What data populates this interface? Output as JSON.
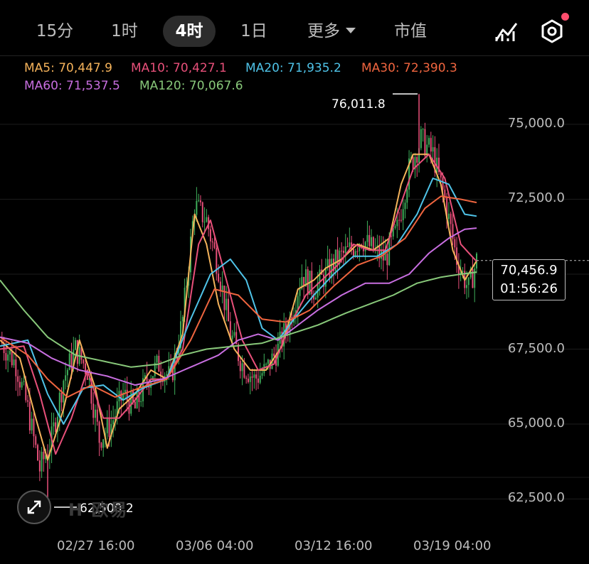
{
  "tabs": [
    {
      "label": "15分",
      "active": false
    },
    {
      "label": "1时",
      "active": false
    },
    {
      "label": "4时",
      "active": true
    },
    {
      "label": "1日",
      "active": false
    },
    {
      "label": "更多",
      "active": false
    },
    {
      "label": "市值",
      "active": false
    }
  ],
  "tools": {
    "indicator_icon": "chart-indicator-icon",
    "settings_icon": "hex-settings-icon",
    "notification_dot_color": "#ff4d6d"
  },
  "ma_legend": [
    {
      "text": "MA5: 70,447.9",
      "color": "#f5b35b"
    },
    {
      "text": "MA10: 70,427.1",
      "color": "#e8507a"
    },
    {
      "text": "MA20: 71,935.2",
      "color": "#4fc3e8"
    },
    {
      "text": "MA30: 72,390.3",
      "color": "#f0653f"
    },
    {
      "text": "MA60: 71,537.5",
      "color": "#c86ee0"
    },
    {
      "text": "MA120: 70,067.6",
      "color": "#88c87a"
    }
  ],
  "watermark": "欧易",
  "current": {
    "price": "70,456.9",
    "countdown": "01:56:26"
  },
  "annotations": {
    "high": "76,011.8",
    "low": "62,500.2"
  },
  "chart_data": {
    "type": "line",
    "title": "",
    "x_tick_labels": [
      "02/27 16:00",
      "03/06 04:00",
      "03/12 16:00",
      "03/19 04:00"
    ],
    "y_tick_labels": [
      "75,000.0",
      "72,500.0",
      "67,500.0",
      "65,000.0",
      "62,500.0"
    ],
    "ylim": [
      62000,
      77000
    ],
    "grid": true,
    "up_color": "#3fb05b",
    "down_color": "#e8507a",
    "candles_summary": {
      "high": 76011.8,
      "low": 62500.2,
      "last": 70456.9
    },
    "close_path": [
      [
        0,
        67800
      ],
      [
        8,
        67000
      ],
      [
        14,
        65500
      ],
      [
        20,
        63500
      ],
      [
        26,
        64500
      ],
      [
        32,
        66500
      ],
      [
        38,
        67500
      ],
      [
        44,
        66800
      ],
      [
        50,
        64500
      ],
      [
        56,
        65000
      ],
      [
        62,
        66000
      ],
      [
        68,
        65500
      ],
      [
        74,
        66500
      ],
      [
        80,
        67000
      ],
      [
        86,
        66500
      ],
      [
        92,
        68500
      ],
      [
        98,
        72300
      ],
      [
        104,
        71800
      ],
      [
        110,
        70200
      ],
      [
        116,
        68000
      ],
      [
        122,
        67000
      ],
      [
        128,
        66500
      ],
      [
        134,
        66800
      ],
      [
        140,
        67500
      ],
      [
        146,
        68500
      ],
      [
        152,
        70000
      ],
      [
        158,
        69500
      ],
      [
        164,
        70000
      ],
      [
        170,
        70500
      ],
      [
        176,
        70800
      ],
      [
        182,
        71200
      ],
      [
        188,
        70800
      ],
      [
        194,
        70500
      ],
      [
        200,
        71500
      ],
      [
        206,
        73500
      ],
      [
        212,
        74500
      ],
      [
        218,
        74000
      ],
      [
        224,
        72500
      ],
      [
        230,
        70500
      ],
      [
        236,
        69500
      ],
      [
        240,
        70456.9
      ]
    ],
    "series": [
      {
        "name": "MA5",
        "color": "#f5b35b",
        "values": [
          [
            0,
            67800
          ],
          [
            10,
            67200
          ],
          [
            18,
            65200
          ],
          [
            24,
            63800
          ],
          [
            32,
            65500
          ],
          [
            40,
            67800
          ],
          [
            48,
            66200
          ],
          [
            54,
            64200
          ],
          [
            60,
            65500
          ],
          [
            68,
            66000
          ],
          [
            76,
            66800
          ],
          [
            84,
            66500
          ],
          [
            92,
            68000
          ],
          [
            98,
            72000
          ],
          [
            104,
            71000
          ],
          [
            110,
            69000
          ],
          [
            118,
            67500
          ],
          [
            126,
            66800
          ],
          [
            134,
            66800
          ],
          [
            142,
            67600
          ],
          [
            150,
            69500
          ],
          [
            158,
            69800
          ],
          [
            164,
            70200
          ],
          [
            172,
            70500
          ],
          [
            180,
            71000
          ],
          [
            188,
            70800
          ],
          [
            196,
            71200
          ],
          [
            202,
            73000
          ],
          [
            208,
            74000
          ],
          [
            216,
            74000
          ],
          [
            222,
            73000
          ],
          [
            228,
            70800
          ],
          [
            234,
            69800
          ],
          [
            240,
            70447.9
          ]
        ]
      },
      {
        "name": "MA10",
        "color": "#e8507a",
        "values": [
          [
            0,
            67500
          ],
          [
            12,
            67600
          ],
          [
            20,
            66000
          ],
          [
            28,
            64000
          ],
          [
            36,
            65200
          ],
          [
            44,
            66800
          ],
          [
            52,
            65200
          ],
          [
            60,
            65200
          ],
          [
            68,
            65800
          ],
          [
            76,
            66500
          ],
          [
            84,
            66500
          ],
          [
            92,
            67500
          ],
          [
            100,
            71000
          ],
          [
            106,
            71800
          ],
          [
            114,
            69800
          ],
          [
            122,
            67800
          ],
          [
            130,
            66800
          ],
          [
            138,
            67000
          ],
          [
            146,
            68300
          ],
          [
            154,
            69300
          ],
          [
            162,
            69800
          ],
          [
            170,
            70300
          ],
          [
            178,
            71000
          ],
          [
            186,
            70800
          ],
          [
            194,
            70800
          ],
          [
            200,
            72000
          ],
          [
            208,
            73500
          ],
          [
            216,
            74000
          ],
          [
            224,
            73200
          ],
          [
            232,
            71000
          ],
          [
            240,
            70427.1
          ]
        ]
      },
      {
        "name": "MA20",
        "color": "#4fc3e8",
        "values": [
          [
            0,
            67600
          ],
          [
            14,
            67800
          ],
          [
            24,
            66000
          ],
          [
            32,
            65000
          ],
          [
            42,
            66200
          ],
          [
            52,
            66300
          ],
          [
            62,
            65800
          ],
          [
            72,
            66200
          ],
          [
            84,
            66500
          ],
          [
            96,
            68500
          ],
          [
            106,
            70000
          ],
          [
            116,
            70500
          ],
          [
            124,
            69800
          ],
          [
            132,
            68200
          ],
          [
            140,
            67800
          ],
          [
            148,
            68500
          ],
          [
            158,
            69300
          ],
          [
            168,
            70000
          ],
          [
            178,
            70600
          ],
          [
            190,
            70600
          ],
          [
            200,
            71000
          ],
          [
            210,
            72000
          ],
          [
            218,
            73200
          ],
          [
            226,
            73000
          ],
          [
            234,
            72000
          ],
          [
            240,
            71935.2
          ]
        ]
      },
      {
        "name": "MA30",
        "color": "#f0653f",
        "values": [
          [
            0,
            67900
          ],
          [
            14,
            67300
          ],
          [
            24,
            66500
          ],
          [
            34,
            65900
          ],
          [
            46,
            66300
          ],
          [
            58,
            65900
          ],
          [
            70,
            66200
          ],
          [
            84,
            66500
          ],
          [
            96,
            67800
          ],
          [
            108,
            69500
          ],
          [
            120,
            69300
          ],
          [
            132,
            68500
          ],
          [
            144,
            68400
          ],
          [
            156,
            68800
          ],
          [
            168,
            69600
          ],
          [
            180,
            70300
          ],
          [
            192,
            70600
          ],
          [
            204,
            71200
          ],
          [
            214,
            72200
          ],
          [
            222,
            72600
          ],
          [
            232,
            72500
          ],
          [
            240,
            72390.3
          ]
        ]
      },
      {
        "name": "MA60",
        "color": "#c86ee0",
        "values": [
          [
            0,
            67900
          ],
          [
            14,
            67700
          ],
          [
            26,
            67200
          ],
          [
            40,
            66800
          ],
          [
            54,
            66600
          ],
          [
            68,
            66300
          ],
          [
            82,
            66500
          ],
          [
            96,
            66900
          ],
          [
            110,
            67300
          ],
          [
            120,
            67800
          ],
          [
            130,
            68000
          ],
          [
            140,
            67800
          ],
          [
            150,
            68300
          ],
          [
            160,
            68800
          ],
          [
            172,
            69300
          ],
          [
            184,
            69700
          ],
          [
            196,
            69700
          ],
          [
            206,
            70000
          ],
          [
            216,
            70700
          ],
          [
            226,
            71200
          ],
          [
            234,
            71500
          ],
          [
            240,
            71537.5
          ]
        ]
      },
      {
        "name": "MA120",
        "color": "#88c87a",
        "values": [
          [
            0,
            69800
          ],
          [
            12,
            68800
          ],
          [
            24,
            67900
          ],
          [
            38,
            67300
          ],
          [
            52,
            67100
          ],
          [
            66,
            66900
          ],
          [
            80,
            67000
          ],
          [
            92,
            67300
          ],
          [
            104,
            67500
          ],
          [
            118,
            67600
          ],
          [
            132,
            67700
          ],
          [
            146,
            68000
          ],
          [
            160,
            68300
          ],
          [
            174,
            68700
          ],
          [
            186,
            69000
          ],
          [
            198,
            69300
          ],
          [
            210,
            69700
          ],
          [
            222,
            69900
          ],
          [
            232,
            70000
          ],
          [
            240,
            70067.6
          ]
        ]
      }
    ]
  }
}
